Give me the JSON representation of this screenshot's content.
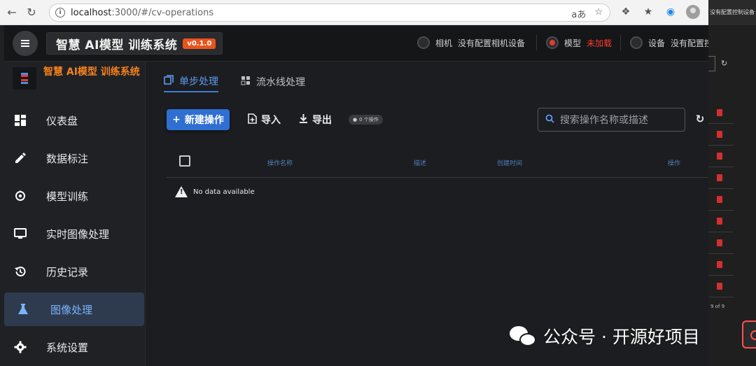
{
  "browser": {
    "url_host": "localhost",
    "url_rest": ":3000/#/cv-operations",
    "reader_icon": "aあ"
  },
  "background_page": {
    "topbar_text": "没有配置控制设备",
    "pagination": "9 of 9"
  },
  "header": {
    "title": "智慧 AI模型 训练系统",
    "version": "v0.1.0",
    "status": [
      {
        "label": "相机",
        "value": "没有配置相机设备",
        "state": "off"
      },
      {
        "label": "模型",
        "value": "未加载",
        "state": "error"
      },
      {
        "label": "设备",
        "value": "没有配置控",
        "state": "off"
      }
    ]
  },
  "sidebar": {
    "brand": "智慧 AI模型 训练系统",
    "items": [
      {
        "label": "仪表盘",
        "icon": "dashboard-icon"
      },
      {
        "label": "数据标注",
        "icon": "pencil-icon"
      },
      {
        "label": "模型训练",
        "icon": "training-icon"
      },
      {
        "label": "实时图像处理",
        "icon": "monitor-icon"
      },
      {
        "label": "历史记录",
        "icon": "history-icon"
      },
      {
        "label": "图像处理",
        "icon": "flask-icon",
        "active": true
      },
      {
        "label": "系统设置",
        "icon": "gear-icon"
      }
    ]
  },
  "main": {
    "tabs": [
      {
        "label": "单步处理",
        "active": true
      },
      {
        "label": "流水线处理",
        "active": false
      }
    ],
    "toolbar": {
      "new_label": "新建操作",
      "import_label": "导入",
      "export_label": "导出",
      "count_label": "0 个操作",
      "search_placeholder": "搜索操作名称或描述"
    },
    "table": {
      "columns": [
        "操作名称",
        "描述",
        "创建时间",
        "操作"
      ],
      "empty_text": "No data available"
    }
  },
  "watermark": "公众号 · 开源好项目",
  "colors": {
    "accent": "#2f6fd1",
    "brand_orange": "#f5821f",
    "badge": "#e8541c",
    "error": "#e53935"
  }
}
